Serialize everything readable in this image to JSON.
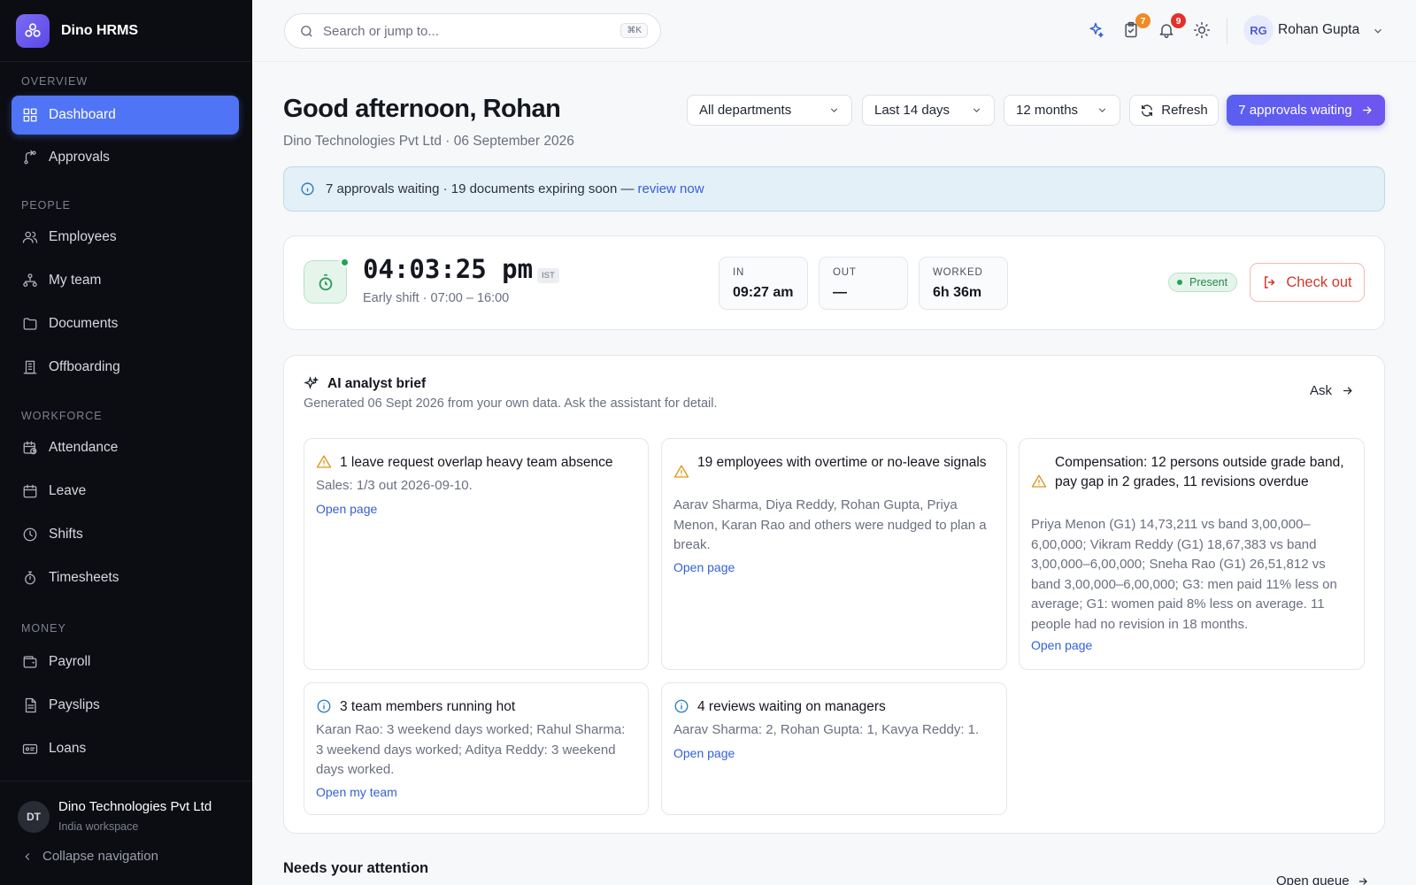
{
  "brand": {
    "name": "Dino HRMS"
  },
  "sidebar": {
    "sections": [
      "OVERVIEW",
      "PEOPLE",
      "WORKFORCE",
      "MONEY"
    ],
    "items": [
      {
        "label": "Dashboard",
        "icon": "dashboard-icon",
        "active": true
      },
      {
        "label": "Approvals",
        "icon": "approvals-icon"
      },
      {
        "label": "Employees",
        "icon": "employees-icon"
      },
      {
        "label": "My team",
        "icon": "team-icon"
      },
      {
        "label": "Documents",
        "icon": "folder-icon"
      },
      {
        "label": "Offboarding",
        "icon": "building-icon"
      },
      {
        "label": "Attendance",
        "icon": "calendar-clock-icon"
      },
      {
        "label": "Leave",
        "icon": "calendar-icon"
      },
      {
        "label": "Shifts",
        "icon": "clock-icon"
      },
      {
        "label": "Timesheets",
        "icon": "stopwatch-icon"
      },
      {
        "label": "Payroll",
        "icon": "wallet-icon"
      },
      {
        "label": "Payslips",
        "icon": "document-icon"
      },
      {
        "label": "Loans",
        "icon": "card-icon"
      }
    ],
    "org": {
      "initials": "DT",
      "name": "Dino Technologies Pvt Ltd",
      "sub": "India workspace"
    },
    "collapse_label": "Collapse navigation"
  },
  "topbar": {
    "search_placeholder": "Search or jump to...",
    "search_shortcut": "⌘K",
    "tasks_count": "7",
    "notifications_count": "9",
    "user": {
      "initials": "RG",
      "name": "Rohan Gupta"
    }
  },
  "header": {
    "greeting": "Good afternoon, Rohan",
    "subline": "Dino Technologies Pvt Ltd · 06 September 2026",
    "filters": {
      "department": "All departments",
      "range": "Last 14 days",
      "period": "12 months"
    },
    "refresh_label": "Refresh",
    "approvals_button": "7 approvals waiting"
  },
  "alert": {
    "text": "7 approvals waiting · 19 documents expiring soon —",
    "link": "review now"
  },
  "attendance": {
    "time": "04:03:25 pm",
    "timezone": "IST",
    "shift": "Early shift · 07:00 – 16:00",
    "stats": [
      {
        "label": "IN",
        "value": "09:27 am"
      },
      {
        "label": "OUT",
        "value": "—"
      },
      {
        "label": "WORKED",
        "value": "6h 36m"
      }
    ],
    "status": "Present",
    "checkout_label": "Check out"
  },
  "ai_brief": {
    "title": "AI analyst brief",
    "subtitle": "Generated 06 Sept 2026 from your own data. Ask the assistant for detail.",
    "ask_label": "Ask",
    "cards": [
      {
        "type": "warning",
        "title": "1 leave request overlap heavy team absence",
        "body": "Sales: 1/3 out 2026-09-10.",
        "link": "Open page"
      },
      {
        "type": "warning",
        "title": "19 employees with overtime or no-leave signals",
        "body": "Aarav Sharma, Diya Reddy, Rohan Gupta, Priya Menon, Karan Rao and others were nudged to plan a break.",
        "link": "Open page"
      },
      {
        "type": "warning",
        "title": "Compensation: 12 persons outside grade band, pay gap in 2 grades, 11 revisions overdue",
        "body": "Priya Menon (G1) 14,73,211 vs band 3,00,000–6,00,000; Vikram Reddy (G1) 18,67,383 vs band 3,00,000–6,00,000; Sneha Rao (G1) 26,51,812 vs band 3,00,000–6,00,000; G3: men paid 11% less on average; G1: women paid 8% less on average. 11 people had no revision in 18 months.",
        "link": "Open page"
      },
      {
        "type": "info",
        "title": "3 team members running hot",
        "body": "Karan Rao: 3 weekend days worked; Rahul Sharma: 3 weekend days worked; Aditya Reddy: 3 weekend days worked.",
        "link": "Open my team"
      },
      {
        "type": "info",
        "title": "4 reviews waiting on managers",
        "body": "Aarav Sharma: 2, Rohan Gupta: 1, Kavya Reddy: 1.",
        "link": "Open page"
      }
    ]
  },
  "attention": {
    "title": "Needs your attention",
    "link": "Open queue"
  },
  "colors": {
    "accent": "#4f74f5",
    "primary_button": "#5a5ff0",
    "success": "#1fa552",
    "danger": "#d0392b",
    "warning": "#d99a1e",
    "info": "#2b7fb8",
    "badge_orange": "#f08a24",
    "badge_red": "#e5302a"
  }
}
